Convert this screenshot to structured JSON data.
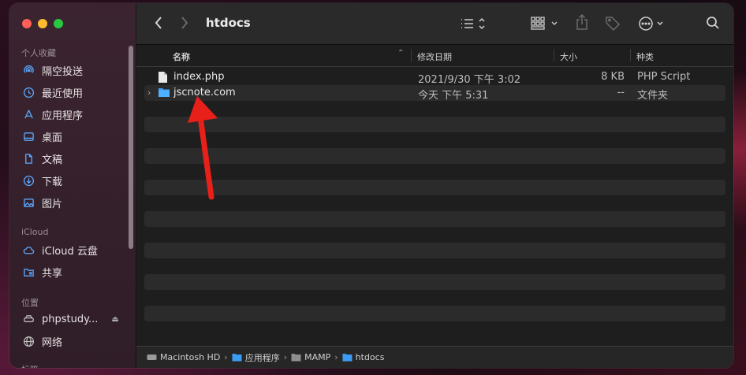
{
  "window": {
    "title": "htdocs"
  },
  "sidebar": {
    "sections": [
      {
        "label": "个人收藏"
      },
      {
        "label": "iCloud"
      },
      {
        "label": "位置"
      },
      {
        "label": "标签"
      }
    ],
    "favorites": [
      {
        "label": "隔空投送",
        "icon": "airdrop-icon"
      },
      {
        "label": "最近使用",
        "icon": "clock-icon"
      },
      {
        "label": "应用程序",
        "icon": "applications-icon"
      },
      {
        "label": "桌面",
        "icon": "desktop-icon"
      },
      {
        "label": "文稿",
        "icon": "document-icon"
      },
      {
        "label": "下载",
        "icon": "download-icon"
      },
      {
        "label": "图片",
        "icon": "photo-icon"
      }
    ],
    "icloud": [
      {
        "label": "iCloud 云盘",
        "icon": "cloud-icon"
      },
      {
        "label": "共享",
        "icon": "shared-folder-icon"
      }
    ],
    "locations": [
      {
        "label": "phpstudy...",
        "icon": "drive-icon"
      },
      {
        "label": "网络",
        "icon": "network-icon"
      }
    ]
  },
  "columns": {
    "name": "名称",
    "date": "修改日期",
    "size": "大小",
    "kind": "种类"
  },
  "files": [
    {
      "name": "index.php",
      "date": "2021/9/30 下午 3:02",
      "size": "8 KB",
      "kind": "PHP Script",
      "icon": "file-icon"
    },
    {
      "name": "jscnote.com",
      "date": "今天 下午 5:31",
      "size": "--",
      "kind": "文件夹",
      "icon": "folder-icon"
    }
  ],
  "pathbar": [
    "Macintosh HD",
    "应用程序",
    "MAMP",
    "htdocs"
  ],
  "colors": {
    "accent": "#3b9cf5",
    "annotation_arrow": "#e8201a"
  }
}
